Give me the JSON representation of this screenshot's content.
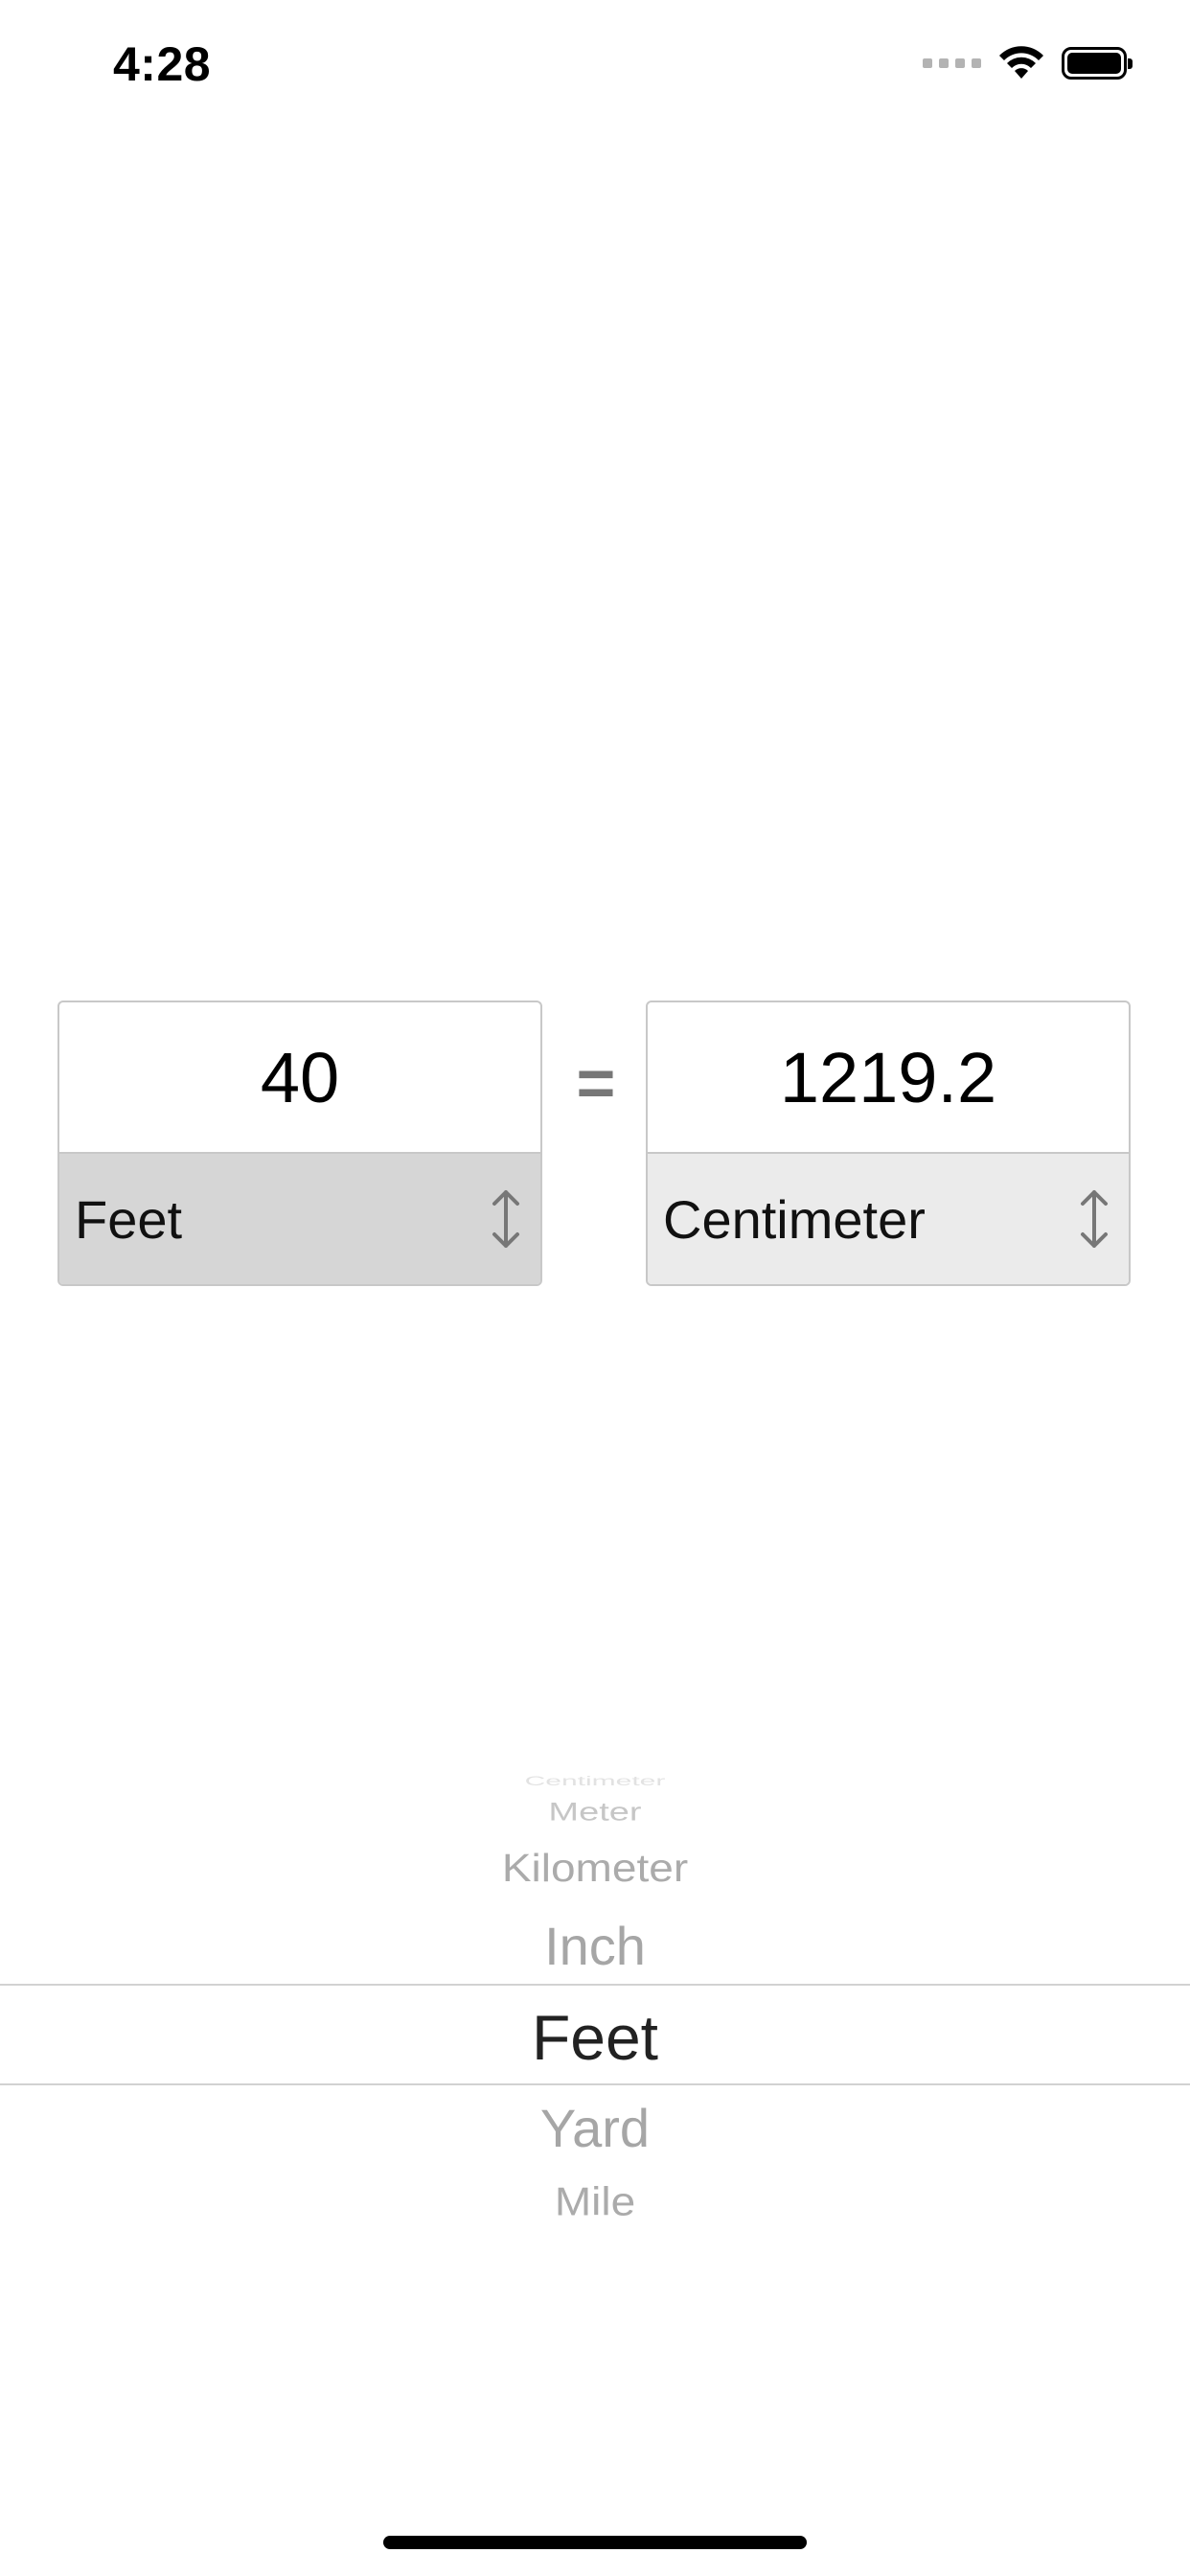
{
  "status_bar": {
    "time": "4:28",
    "icons": [
      "cellular-signal-icon",
      "wifi-icon",
      "battery-icon"
    ]
  },
  "converter": {
    "from": {
      "value": "40",
      "unit": "Feet"
    },
    "equals": "=",
    "to": {
      "value": "1219.2",
      "unit": "Centimeter"
    }
  },
  "picker": {
    "items": [
      "Centimeter",
      "Meter",
      "Kilometer",
      "Inch",
      "Feet",
      "Yard",
      "Mile"
    ],
    "selected": "Feet"
  }
}
